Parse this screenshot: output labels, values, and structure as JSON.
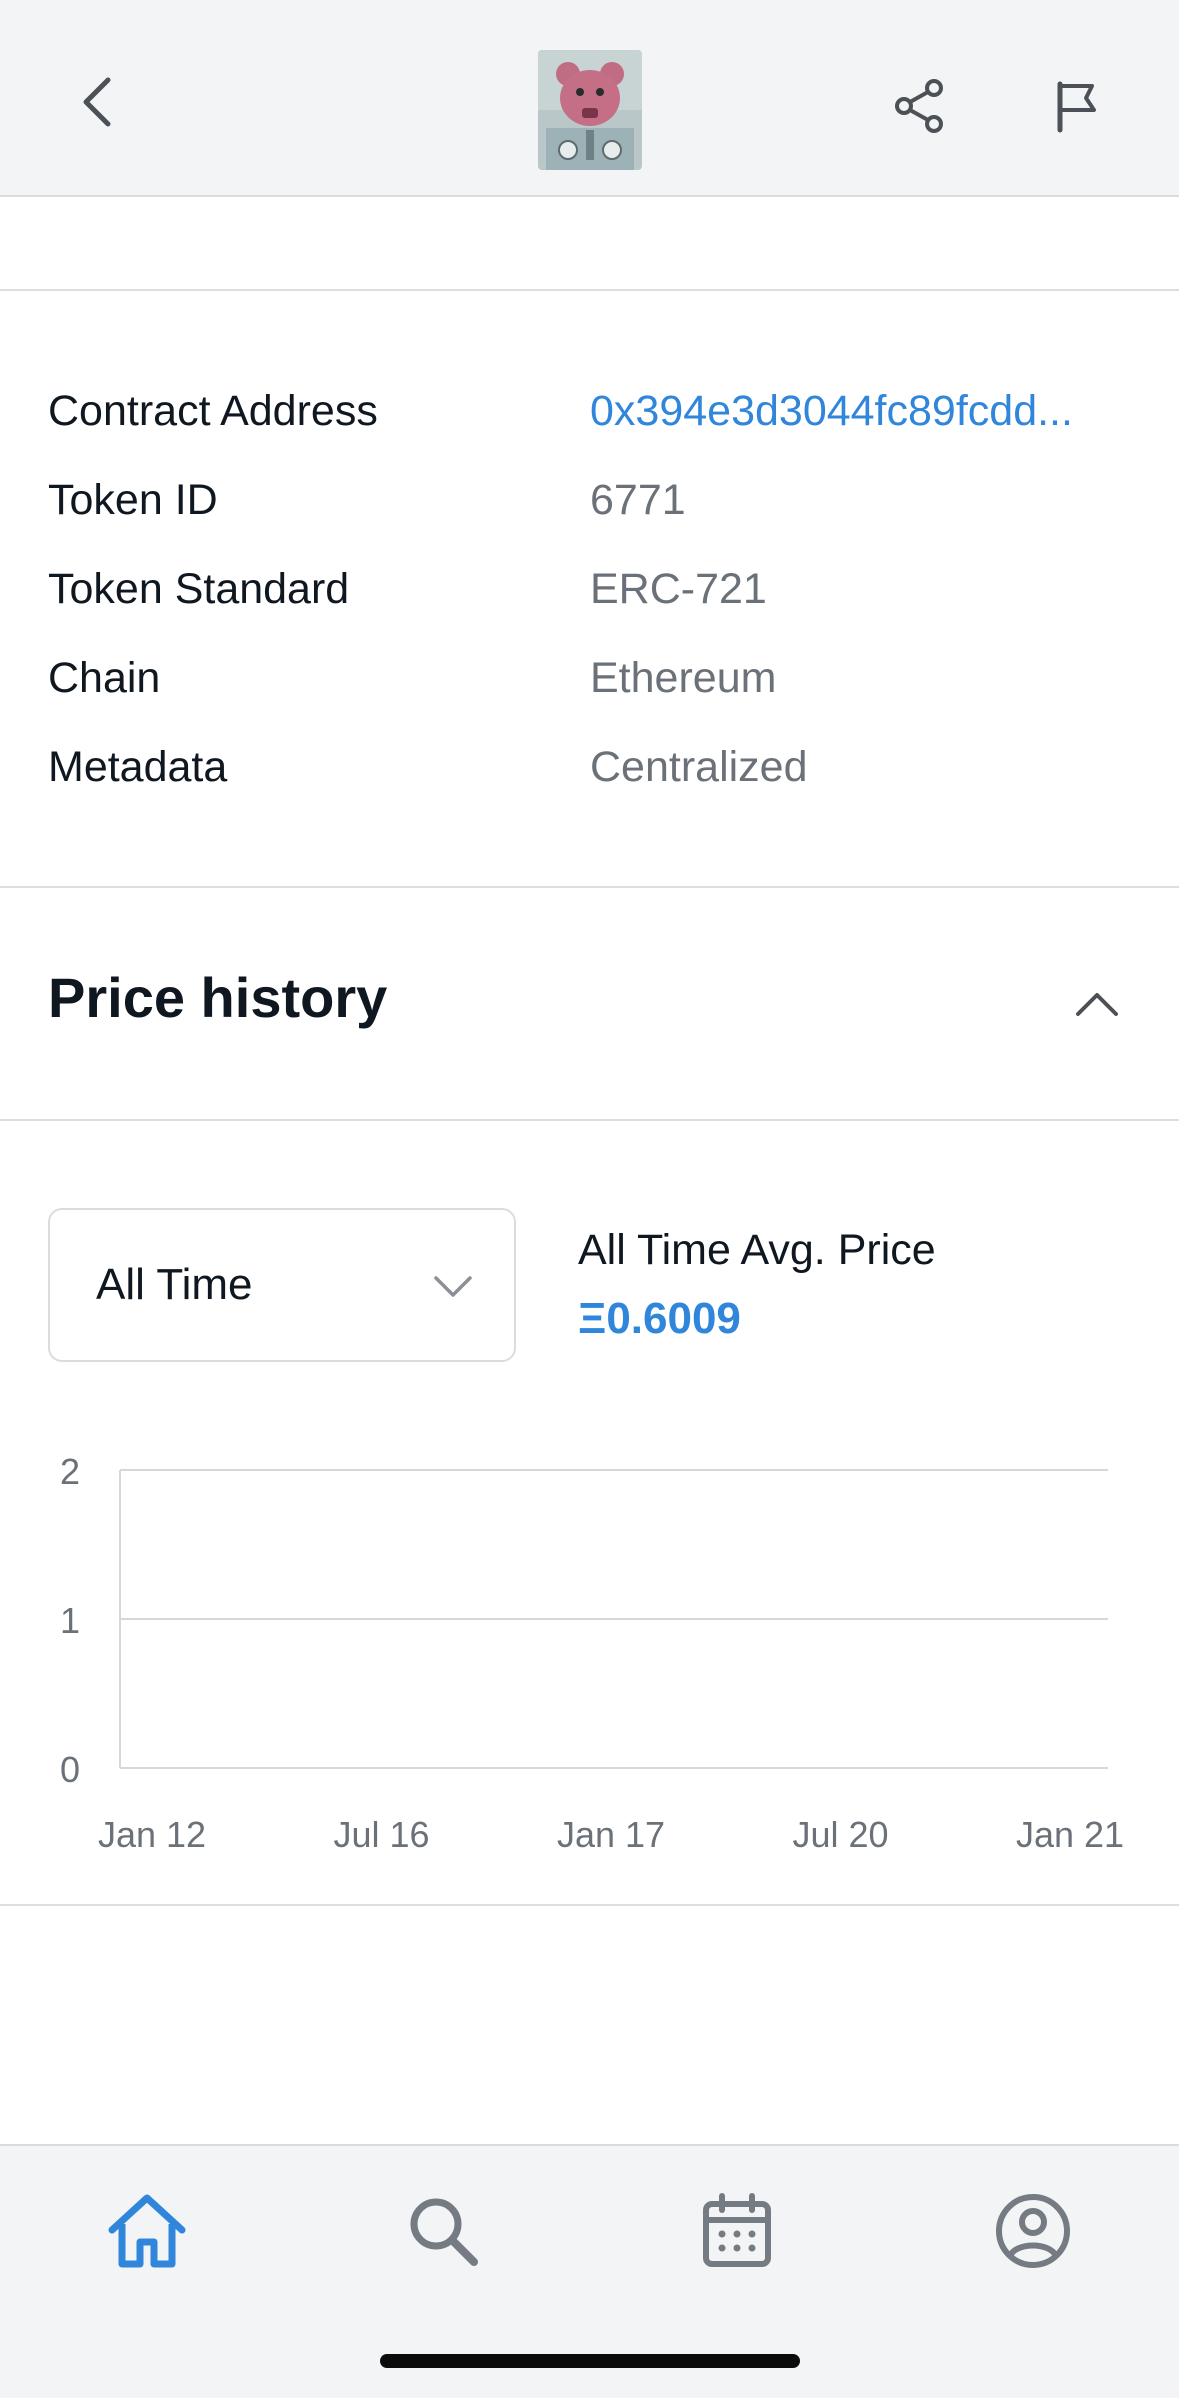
{
  "header": {
    "back_icon": "chevron-left-icon",
    "share_icon": "share-icon",
    "flag_icon": "flag-icon",
    "thumbnail": "nft-bear-thumbnail"
  },
  "details": [
    {
      "label": "Contract Address",
      "value": "0x394e3d3044fc89fcdd..."
    },
    {
      "label": "Token ID",
      "value": "6771"
    },
    {
      "label": "Token Standard",
      "value": "ERC-721"
    },
    {
      "label": "Chain",
      "value": "Ethereum"
    },
    {
      "label": "Metadata",
      "value": "Centralized"
    }
  ],
  "price_history": {
    "title": "Price history",
    "filter": {
      "selected": "All Time"
    },
    "avg_label": "All Time Avg. Price",
    "avg_value": "Ξ0.6009"
  },
  "chart_data": {
    "type": "line",
    "title": "",
    "xlabel": "",
    "ylabel": "",
    "x_ticks": [
      "Jan 12",
      "Jul 16",
      "Jan 17",
      "Jul 20",
      "Jan 21"
    ],
    "y_ticks": [
      "2",
      "1",
      "0"
    ],
    "ylim": [
      0,
      2
    ],
    "series": [],
    "grid": true
  },
  "bottom_nav": [
    {
      "icon": "home-icon",
      "active": true
    },
    {
      "icon": "search-icon",
      "active": false
    },
    {
      "icon": "calendar-icon",
      "active": false
    },
    {
      "icon": "profile-icon",
      "active": false
    }
  ],
  "colors": {
    "accent": "#2f86da",
    "text_primary": "#0f1720",
    "text_secondary": "#6b7178",
    "icon_gray": "#757b82"
  }
}
